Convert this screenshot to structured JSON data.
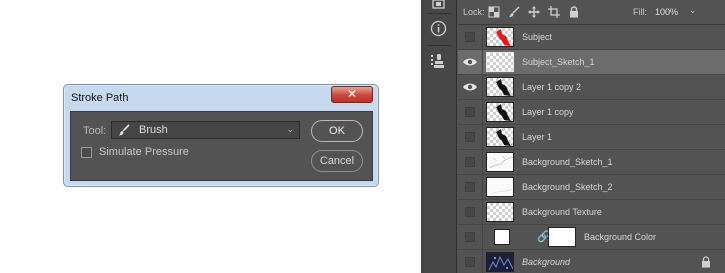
{
  "dialog": {
    "title": "Stroke Path",
    "close_glyph": "✕",
    "tool_label": "Tool:",
    "tool_value": "Brush",
    "tool_icon": "brush-icon",
    "simulate_pressure_label": "Simulate Pressure",
    "simulate_pressure_checked": false,
    "ok_label": "OK",
    "cancel_label": "Cancel"
  },
  "layers_panel": {
    "lock_label": "Lock:",
    "lock_icons": [
      "lock-transparent-pixels-icon",
      "lock-image-pixels-icon",
      "lock-position-icon",
      "lock-artboard-icon",
      "lock-all-icon"
    ],
    "fill_label": "Fill:",
    "fill_value": "100%",
    "toolstrip_icons": [
      "history-icon",
      "info-icon",
      "clone-source-icon"
    ],
    "layers": [
      {
        "name": "Subject",
        "visible": false,
        "thumb": "red-subject",
        "selected": false
      },
      {
        "name": "Subject_Sketch_1",
        "visible": true,
        "thumb": "transparent",
        "selected": true
      },
      {
        "name": "Layer 1 copy 2",
        "visible": true,
        "thumb": "black-subject",
        "selected": false
      },
      {
        "name": "Layer 1 copy",
        "visible": false,
        "thumb": "black-subject",
        "selected": false
      },
      {
        "name": "Layer 1",
        "visible": false,
        "thumb": "black-subject",
        "selected": false
      },
      {
        "name": "Background_Sketch_1",
        "visible": false,
        "thumb": "sketch",
        "selected": false
      },
      {
        "name": "Background_Sketch_2",
        "visible": false,
        "thumb": "plain",
        "selected": false
      },
      {
        "name": "Background Texture",
        "visible": false,
        "thumb": "transparent",
        "selected": false
      },
      {
        "name": "Background Color",
        "visible": false,
        "thumb": "fill",
        "selected": false
      },
      {
        "name": "Background",
        "visible": false,
        "thumb": "dark",
        "selected": false,
        "locked": true
      }
    ]
  }
}
